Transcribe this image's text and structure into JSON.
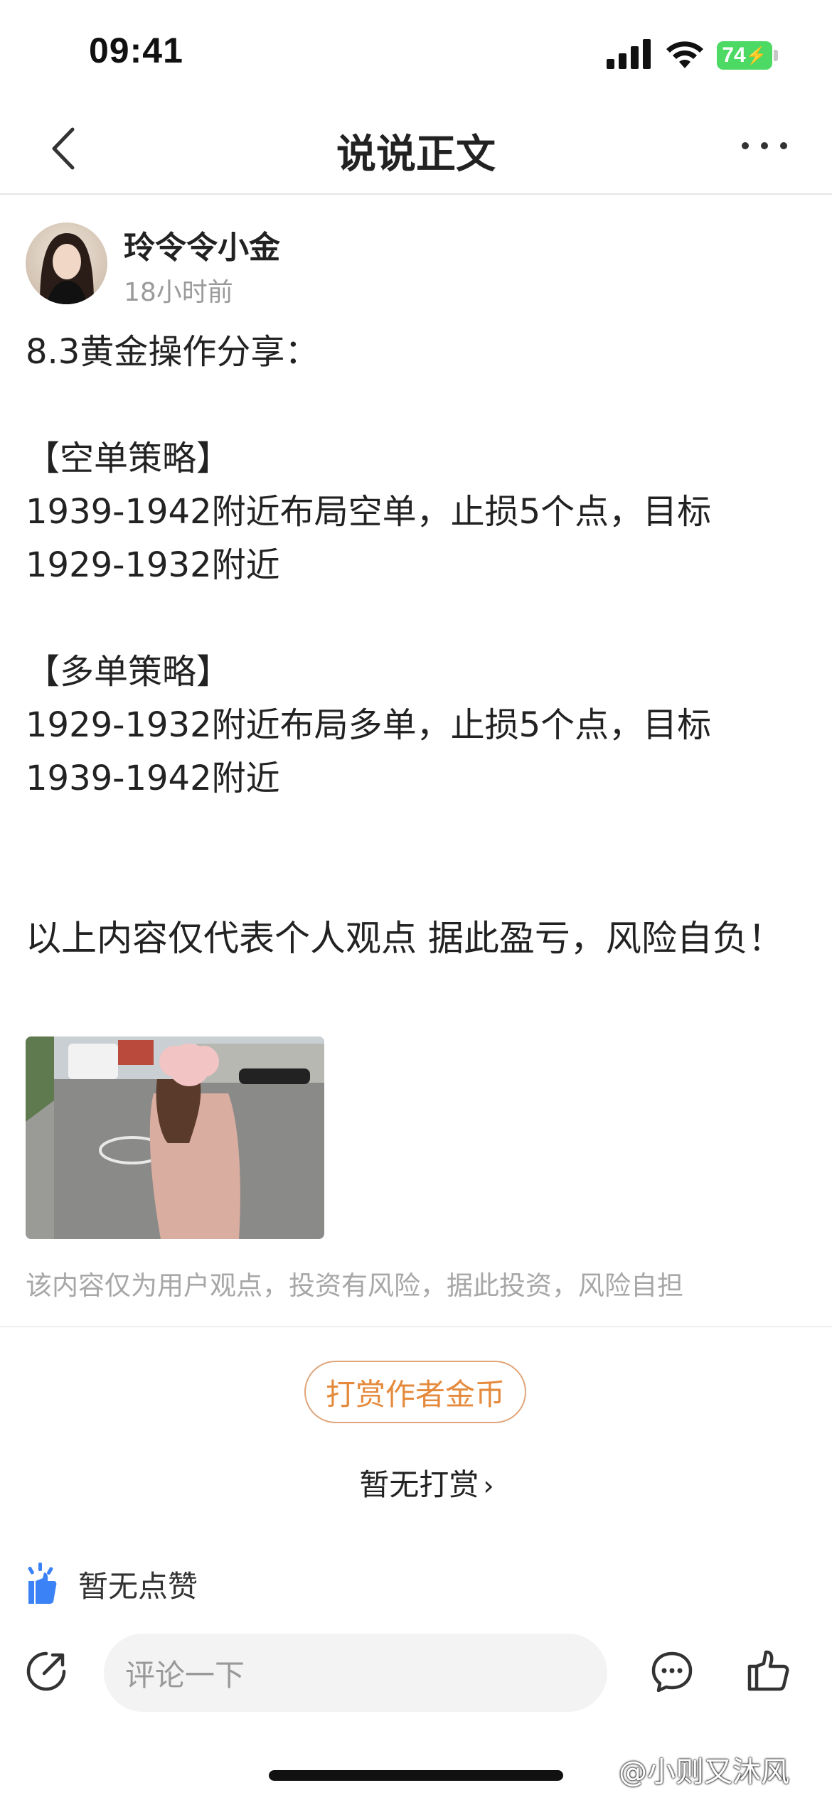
{
  "status_bar": {
    "time": "09:41",
    "battery": "74",
    "icons": [
      "signal-icon",
      "wifi-icon",
      "battery-icon"
    ]
  },
  "nav": {
    "title": "说说正文",
    "back_icon": "chevron-left-icon",
    "more_icon": "more-dots-icon"
  },
  "author": {
    "name": "玲令令小金",
    "time": "18小时前"
  },
  "post": {
    "lines": [
      "8.3黄金操作分享：",
      "",
      "【空单策略】",
      "1939-1942附近布局空单，止损5个点，目标",
      "1929-1932附近",
      "",
      "【多单策略】",
      "1929-1932附近布局多单，止损5个点，目标",
      "1939-1942附近"
    ],
    "disclaimer": "以上内容仅代表个人观点 据此盈亏，风险自负！"
  },
  "risk_note": "该内容仅为用户观点，投资有风险，据此投资，风险自担",
  "tip": {
    "button_label": "打赏作者金币",
    "status": "暂无打赏",
    "chevron": "›"
  },
  "likes": {
    "text": "暂无点赞"
  },
  "bottom_bar": {
    "comment_placeholder": "评论一下",
    "icons": [
      "share-icon",
      "comment-icon",
      "thumbs-up-icon"
    ]
  },
  "watermark": "@小则又沐风",
  "colors": {
    "accent_orange": "#e58a3c",
    "tip_border": "#e0a57a",
    "like_blue": "#3b82f6",
    "battery_green": "#4cd964"
  }
}
